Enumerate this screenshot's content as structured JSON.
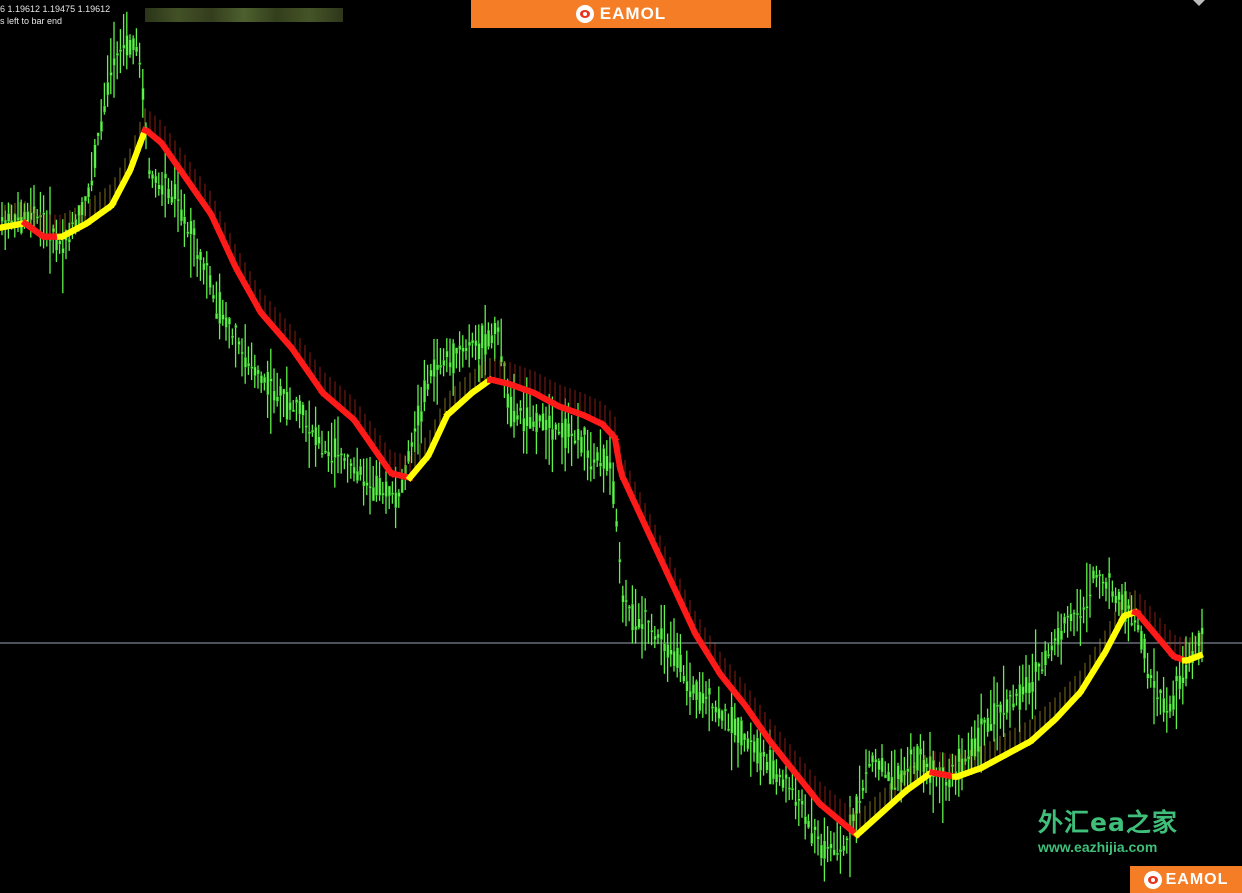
{
  "header": {
    "ohlc_text": "6 1.19612 1.19475 1.19612",
    "timer_text": "s left to bar end"
  },
  "brand": {
    "logo_text": "EAMOL",
    "watermark_cn": "外汇ea之家",
    "watermark_url": "www.eazhijia.com",
    "color": "#f47d25"
  },
  "colors": {
    "background": "#000000",
    "candle": "#5ff24a",
    "candle_edge": "#1c7a18",
    "ma_up": "#ffff00",
    "ma_down": "#ff1a1a",
    "price_line": "#9aa3b3",
    "watermark": "#3fbf7a"
  },
  "chart_data": {
    "type": "line",
    "description_series": [
      {
        "role": "price",
        "style": "green-bars"
      },
      {
        "role": "moving-average",
        "style": "yellow-up-red-down"
      }
    ],
    "price_level_line": 0.72,
    "price_path": [
      [
        0.0,
        0.25
      ],
      [
        0.03,
        0.24
      ],
      [
        0.05,
        0.28
      ],
      [
        0.07,
        0.22
      ],
      [
        0.09,
        0.06
      ],
      [
        0.11,
        0.05
      ],
      [
        0.12,
        0.2
      ],
      [
        0.14,
        0.22
      ],
      [
        0.16,
        0.29
      ],
      [
        0.18,
        0.36
      ],
      [
        0.2,
        0.41
      ],
      [
        0.22,
        0.44
      ],
      [
        0.24,
        0.46
      ],
      [
        0.26,
        0.5
      ],
      [
        0.28,
        0.52
      ],
      [
        0.3,
        0.54
      ],
      [
        0.32,
        0.56
      ],
      [
        0.33,
        0.5
      ],
      [
        0.345,
        0.42
      ],
      [
        0.36,
        0.4
      ],
      [
        0.38,
        0.39
      ],
      [
        0.4,
        0.37
      ],
      [
        0.41,
        0.46
      ],
      [
        0.43,
        0.47
      ],
      [
        0.45,
        0.48
      ],
      [
        0.47,
        0.5
      ],
      [
        0.49,
        0.52
      ],
      [
        0.495,
        0.57
      ],
      [
        0.5,
        0.68
      ],
      [
        0.52,
        0.7
      ],
      [
        0.54,
        0.73
      ],
      [
        0.56,
        0.78
      ],
      [
        0.58,
        0.8
      ],
      [
        0.6,
        0.83
      ],
      [
        0.62,
        0.86
      ],
      [
        0.64,
        0.89
      ],
      [
        0.66,
        0.95
      ],
      [
        0.68,
        0.95
      ],
      [
        0.7,
        0.85
      ],
      [
        0.72,
        0.87
      ],
      [
        0.74,
        0.85
      ],
      [
        0.76,
        0.88
      ],
      [
        0.78,
        0.84
      ],
      [
        0.8,
        0.8
      ],
      [
        0.82,
        0.78
      ],
      [
        0.84,
        0.74
      ],
      [
        0.855,
        0.7
      ],
      [
        0.87,
        0.69
      ],
      [
        0.88,
        0.64
      ],
      [
        0.89,
        0.66
      ],
      [
        0.905,
        0.68
      ],
      [
        0.915,
        0.7
      ],
      [
        0.925,
        0.76
      ],
      [
        0.94,
        0.8
      ],
      [
        0.955,
        0.74
      ],
      [
        0.97,
        0.71
      ]
    ],
    "ma_path": [
      [
        0.0,
        0.255
      ],
      [
        0.02,
        0.25
      ],
      [
        0.035,
        0.265
      ],
      [
        0.05,
        0.265
      ],
      [
        0.07,
        0.25
      ],
      [
        0.09,
        0.23
      ],
      [
        0.105,
        0.19
      ],
      [
        0.117,
        0.145
      ],
      [
        0.13,
        0.16
      ],
      [
        0.15,
        0.2
      ],
      [
        0.17,
        0.24
      ],
      [
        0.19,
        0.3
      ],
      [
        0.21,
        0.35
      ],
      [
        0.235,
        0.39
      ],
      [
        0.26,
        0.44
      ],
      [
        0.285,
        0.47
      ],
      [
        0.3,
        0.5
      ],
      [
        0.315,
        0.53
      ],
      [
        0.33,
        0.535
      ],
      [
        0.345,
        0.51
      ],
      [
        0.36,
        0.465
      ],
      [
        0.38,
        0.44
      ],
      [
        0.395,
        0.425
      ],
      [
        0.41,
        0.43
      ],
      [
        0.43,
        0.44
      ],
      [
        0.45,
        0.455
      ],
      [
        0.47,
        0.465
      ],
      [
        0.485,
        0.475
      ],
      [
        0.495,
        0.49
      ],
      [
        0.5,
        0.53
      ],
      [
        0.52,
        0.59
      ],
      [
        0.54,
        0.65
      ],
      [
        0.56,
        0.71
      ],
      [
        0.58,
        0.755
      ],
      [
        0.6,
        0.79
      ],
      [
        0.62,
        0.83
      ],
      [
        0.64,
        0.865
      ],
      [
        0.66,
        0.9
      ],
      [
        0.69,
        0.935
      ],
      [
        0.71,
        0.91
      ],
      [
        0.73,
        0.885
      ],
      [
        0.75,
        0.865
      ],
      [
        0.77,
        0.87
      ],
      [
        0.79,
        0.86
      ],
      [
        0.81,
        0.845
      ],
      [
        0.83,
        0.83
      ],
      [
        0.85,
        0.805
      ],
      [
        0.87,
        0.775
      ],
      [
        0.89,
        0.73
      ],
      [
        0.905,
        0.69
      ],
      [
        0.915,
        0.685
      ],
      [
        0.93,
        0.71
      ],
      [
        0.945,
        0.735
      ],
      [
        0.955,
        0.74
      ],
      [
        0.968,
        0.733
      ]
    ]
  }
}
